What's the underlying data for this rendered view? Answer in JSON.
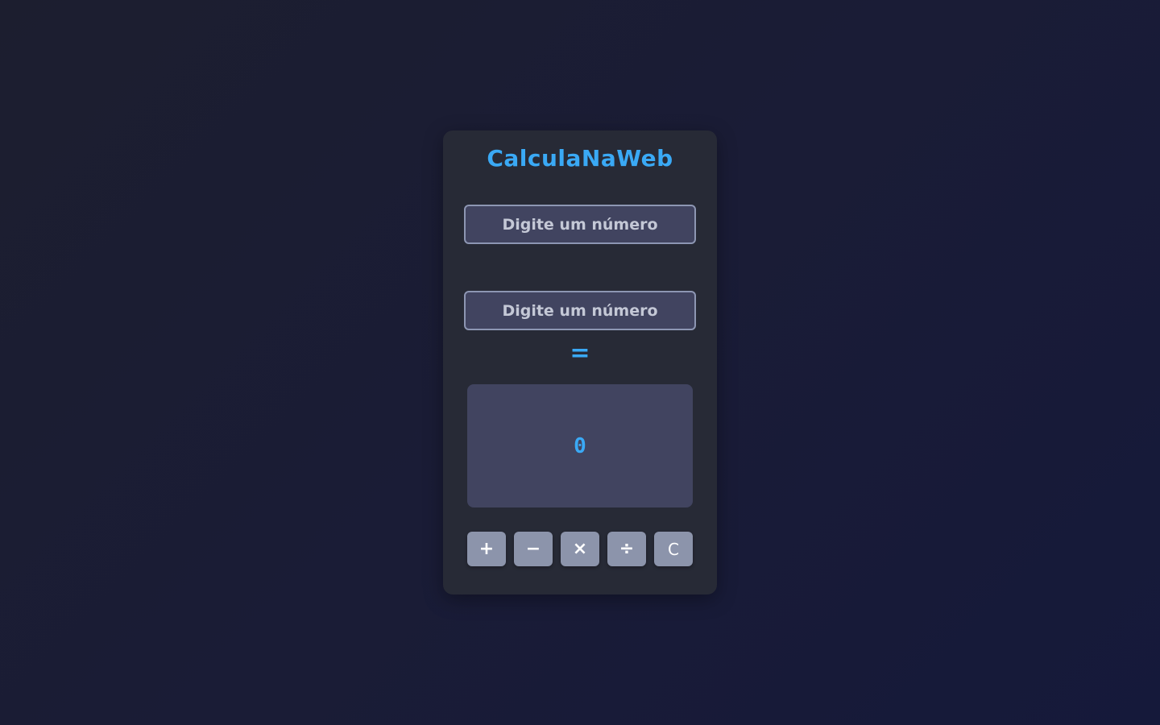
{
  "app": {
    "title": "CalculaNaWeb"
  },
  "inputs": {
    "first": {
      "placeholder": "Digite um número",
      "value": ""
    },
    "second": {
      "placeholder": "Digite um número",
      "value": ""
    }
  },
  "equals_sign": "=",
  "result": {
    "value": "0"
  },
  "operations": [
    {
      "label": "+",
      "icon": "plus-icon"
    },
    {
      "label": "−",
      "icon": "minus-icon"
    },
    {
      "label": "×",
      "icon": "multiply-icon"
    },
    {
      "label": "÷",
      "icon": "divide-icon"
    },
    {
      "label": "C",
      "icon": "clear-icon"
    }
  ],
  "colors": {
    "accent": "#3aa9f5",
    "card": "#272a36",
    "field": "#414460",
    "button": "#8c94ab"
  }
}
